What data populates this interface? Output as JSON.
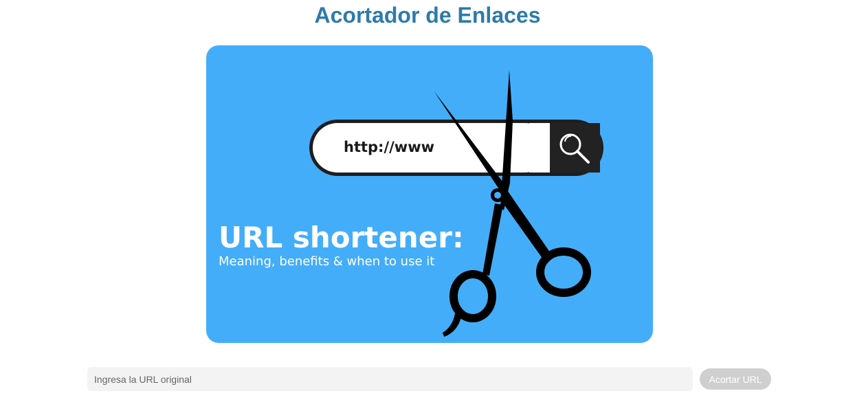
{
  "header": {
    "title": "Acortador de Enlaces"
  },
  "hero_image": {
    "url_bar_text": "http://www",
    "headline": "URL shortener:",
    "subheadline": "Meaning, benefits & when to use it",
    "icons": [
      "search-icon",
      "scissors-icon"
    ],
    "colors": {
      "background": "#44adf9",
      "bar_dark": "#222222"
    }
  },
  "form": {
    "url_input": {
      "placeholder": "Ingresa la URL original",
      "value": ""
    },
    "submit_label": "Acortar URL"
  },
  "colors": {
    "title": "#2e7bab",
    "button_disabled": "#cfcfcf",
    "input_background": "#f3f3f3"
  }
}
